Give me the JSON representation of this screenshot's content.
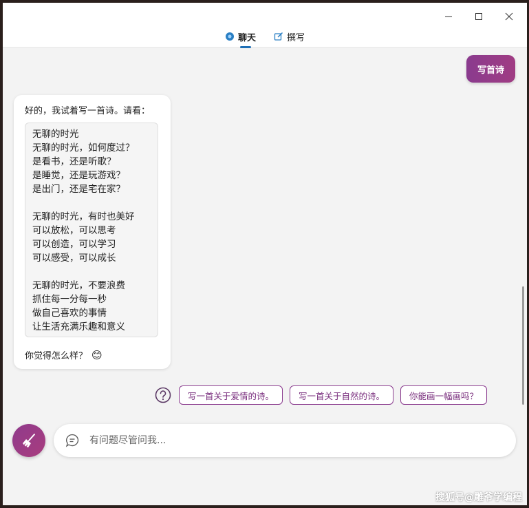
{
  "tabs": [
    {
      "label": "聊天",
      "icon": "chat-icon",
      "active": true
    },
    {
      "label": "撰写",
      "icon": "compose-icon",
      "active": false
    }
  ],
  "user_message": "写首诗",
  "bot": {
    "intro": "好的，我试着写一首诗。请看：",
    "poem": {
      "stanza1": [
        "无聊的时光",
        "无聊的时光，如何度过？",
        "是看书，还是听歌？",
        "是睡觉，还是玩游戏？",
        "是出门，还是宅在家？"
      ],
      "stanza2": [
        "无聊的时光，有时也美好",
        "可以放松，可以思考",
        "可以创造，可以学习",
        "可以感受，可以成长"
      ],
      "stanza3": [
        "无聊的时光，不要浪费",
        "抓住每一分每一秒",
        "做自己喜欢的事情",
        "让生活充满乐趣和意义"
      ]
    },
    "outro": "你觉得怎么样？",
    "outro_emoji": "😊"
  },
  "suggestions": [
    "写一首关于爱情的诗。",
    "写一首关于自然的诗。",
    "你能画一幅画吗？"
  ],
  "input": {
    "placeholder": "有问题尽管问我..."
  },
  "watermark": "搜狐号@雕爷学编程",
  "colors": {
    "accent": "#8a3b8e",
    "tab_underline": "#1f6fb5"
  }
}
